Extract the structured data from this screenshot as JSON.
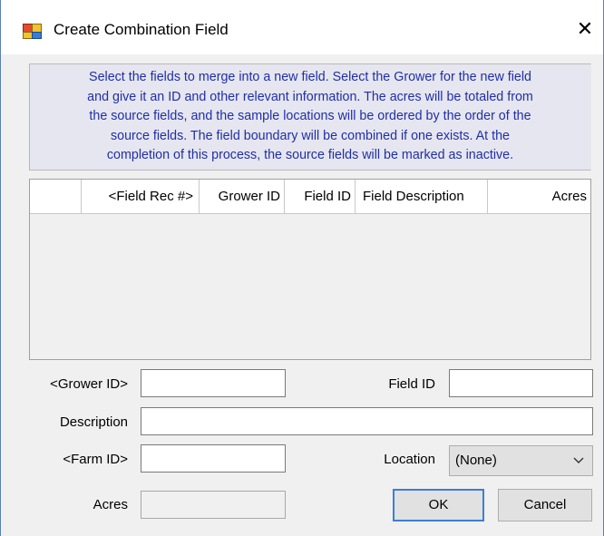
{
  "window": {
    "title": "Create Combination Field",
    "close_glyph": "✕"
  },
  "instructions": [
    "Select the fields to merge into a new field.  Select the Grower for the new field",
    "and give it an ID and other relevant information.  The acres will be totaled from",
    "the source fields, and the sample locations will be ordered by the order of the",
    "source fields.  The field boundary will be combined if one exists.  At the",
    "completion of this process, the source fields will be marked as inactive."
  ],
  "grid": {
    "columns": [
      "",
      "<Field Rec #>",
      "Grower ID",
      "Field ID",
      "Field Description",
      "Acres"
    ],
    "rows": []
  },
  "form": {
    "grower_id_label": "<Grower ID>",
    "grower_id_value": "",
    "field_id_label": "Field ID",
    "field_id_value": "",
    "description_label": "Description",
    "description_value": "",
    "farm_id_label": "<Farm ID>",
    "farm_id_value": "",
    "location_label": "Location",
    "location_selected": "(None)",
    "acres_label": "Acres",
    "acres_value": ""
  },
  "buttons": {
    "ok_label": "OK",
    "cancel_label": "Cancel"
  },
  "colors": {
    "instruction_text": "#1f2fa8",
    "default_button_border": "#3c7fd6"
  }
}
